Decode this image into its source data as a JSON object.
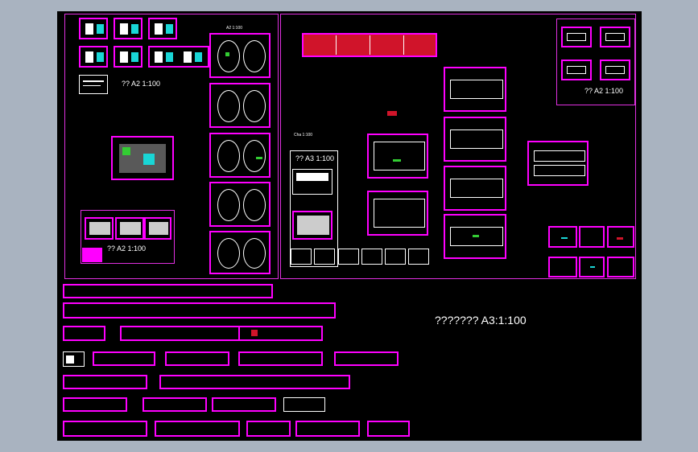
{
  "left_panel": {
    "scale_label": "?? A2 1:100",
    "scale_label_lower": "?? A2 1:100",
    "mini_heading": "A2 1:100"
  },
  "middle_panel": {
    "scale_label": "?? A3 1:100",
    "floor_note": "Cha 1:100"
  },
  "right_top_panel": {
    "scale_label": "?? A2 1:100"
  },
  "bottom": {
    "scale_label": "??????? A3:1:100"
  },
  "colors": {
    "canvas": "#000000",
    "frame": "#ff00ff",
    "outer": "#a9b3c0",
    "accent_cyan": "#19d6d6",
    "accent_red": "#d0142a"
  }
}
